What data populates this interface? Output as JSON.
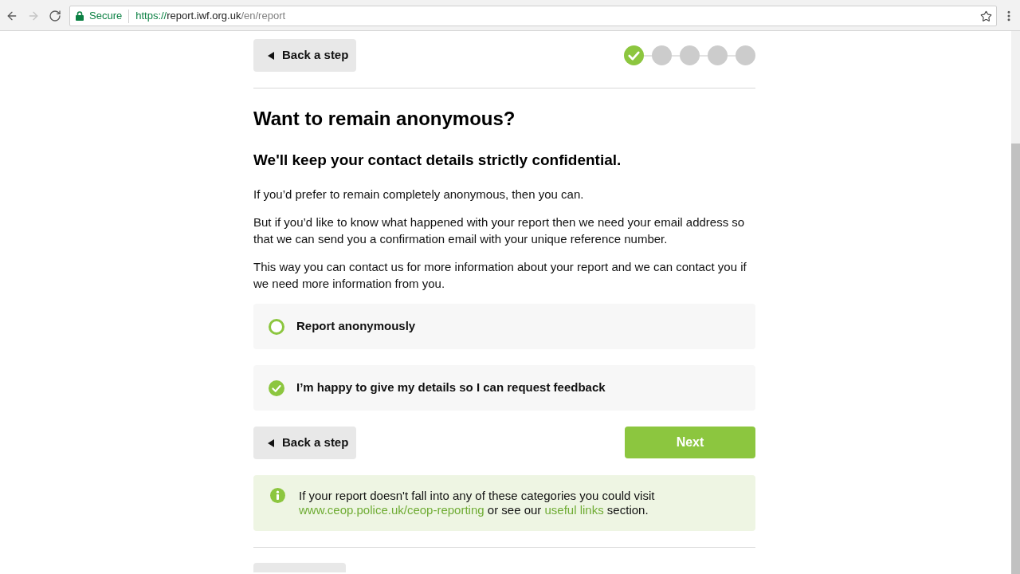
{
  "browser": {
    "nav_buttons": [
      {
        "kind": "back",
        "disabled": false
      },
      {
        "kind": "forward",
        "disabled": true
      },
      {
        "kind": "reload",
        "disabled": false
      }
    ],
    "security_label": "Secure",
    "url": {
      "scheme": "https://",
      "host": "report.iwf.org.uk",
      "path": "/en/report"
    }
  },
  "top_back_button": {
    "label": "Back a step"
  },
  "progress_steps": [
    {
      "done": true
    },
    {
      "done": false
    },
    {
      "done": false
    },
    {
      "done": false
    },
    {
      "done": false
    }
  ],
  "heading": "Want to remain anonymous?",
  "subheading": "We'll keep your contact details strictly confidential.",
  "paragraphs": [
    "If you’d prefer to remain completely anonymous, then you can.",
    "But if you’d like to know what happened with your report then we need your email address so that we can send you a confirmation email with your unique reference number.",
    "This way you can contact us for more information about your report and we can contact you if we need more information from you."
  ],
  "options": [
    {
      "label": "Report anonymously",
      "selected": false
    },
    {
      "label": "I’m happy to give my details so I can request feedback",
      "selected": true
    }
  ],
  "bottom_back_button": {
    "label": "Back a step"
  },
  "next_button": {
    "label": "Next"
  },
  "info": {
    "segments": [
      {
        "kind": "text",
        "text": "If your report doesn't fall into any of these categories you could visit "
      },
      {
        "kind": "link",
        "text": "www.ceop.police.uk/ceop-reporting"
      },
      {
        "kind": "text",
        "text": " or see our "
      },
      {
        "kind": "link",
        "text": "useful links"
      },
      {
        "kind": "text",
        "text": " section."
      }
    ]
  }
}
